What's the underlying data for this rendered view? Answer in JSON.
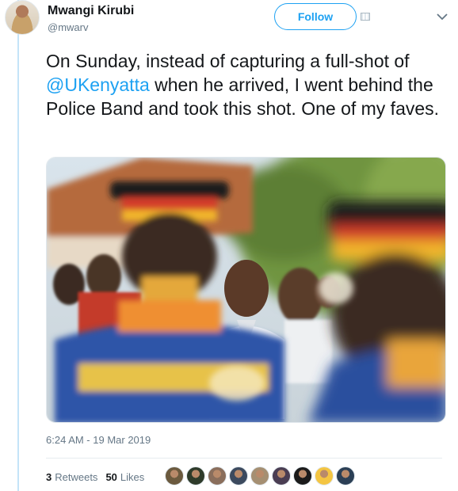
{
  "user": {
    "name": "Mwangi Kirubi",
    "handle": "@mwarv"
  },
  "follow_label": "Follow",
  "tweet": {
    "text_before": "On Sunday, instead of capturing a full-shot of ",
    "mention": "@UKenyatta",
    "text_after": " when he arrived, I went behind the Police Band and took this shot. One of my faves."
  },
  "timestamp": "6:24 AM - 19 Mar 2019",
  "stats": {
    "retweets_count": "3",
    "retweets_label": "Retweets",
    "likes_count": "50",
    "likes_label": "Likes"
  },
  "likers": [
    {
      "icon": "avatar-1",
      "color": "#6b5a3e"
    },
    {
      "icon": "avatar-2",
      "color": "#2e3b2a"
    },
    {
      "icon": "avatar-3",
      "color": "#8a6e5c"
    },
    {
      "icon": "avatar-4",
      "color": "#3c4a5e"
    },
    {
      "icon": "avatar-5",
      "color": "#a58f72"
    },
    {
      "icon": "avatar-6",
      "color": "#4a3d52"
    },
    {
      "icon": "avatar-7",
      "color": "#1b1b1b"
    },
    {
      "icon": "avatar-8",
      "color": "#f4c542"
    },
    {
      "icon": "avatar-9",
      "color": "#2b3f55"
    }
  ],
  "colors": {
    "accent": "#1da1f2",
    "secondary_text": "#657786"
  }
}
